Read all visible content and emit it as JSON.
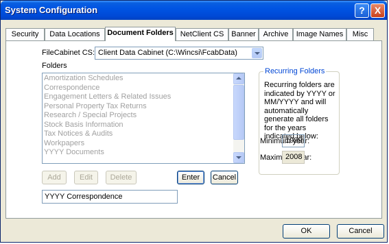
{
  "window": {
    "title": "System Configuration"
  },
  "title_buttons": {
    "help": "?",
    "close": "X"
  },
  "tabs": [
    {
      "label": "Security"
    },
    {
      "label": "Data Locations"
    },
    {
      "label": "Document Folders",
      "active": true
    },
    {
      "label": "NetClient CS"
    },
    {
      "label": "Banner"
    },
    {
      "label": "Archive"
    },
    {
      "label": "Image Names"
    },
    {
      "label": "Misc"
    }
  ],
  "filecabinet": {
    "label": "FileCabinet CS:",
    "value": "Client Data Cabinet (C:\\Wincsi\\FcabData)"
  },
  "folders": {
    "label": "Folders",
    "items": [
      "Amortization Schedules",
      "Correspondence",
      "Engagement Letters & Related Issues",
      "Personal Property Tax Returns",
      "Research / Special Projects",
      "Stock Basis Information",
      "Tax Notices & Audits",
      "Workpapers",
      "YYYY Documents"
    ]
  },
  "buttons": {
    "add": "Add",
    "edit": "Edit",
    "delete": "Delete",
    "enter": "Enter",
    "cancel": "Cancel"
  },
  "folder_input": {
    "value": "YYYY Correspondence"
  },
  "recurring": {
    "title": "Recurring Folders",
    "description": "Recurring folders are indicated by YYYY or MM/YYYY and will automatically generate all folders for the years indicated below:",
    "minimum_label": "Minimum year:",
    "minimum_value": "1999",
    "maximum_label": "Maximum year:",
    "maximum_value": "2008"
  },
  "dialog": {
    "ok": "OK",
    "cancel": "Cancel"
  }
}
